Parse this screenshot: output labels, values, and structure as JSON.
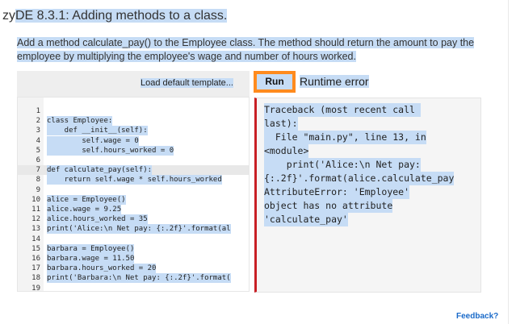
{
  "header": {
    "prefix": "zy",
    "title": "DE 8.3.1: Adding methods to a class."
  },
  "description": "Add a method calculate_pay() to the Employee class. The method should return the amount to pay the employee by multiplying the employee's wage and number of hours worked.",
  "toolbar": {
    "load_template_label": "Load default template...",
    "run_label": "Run",
    "status": "Runtime error"
  },
  "editor": {
    "lines": [
      {
        "num": "1",
        "code": ""
      },
      {
        "num": "2",
        "code": "class Employee:"
      },
      {
        "num": "3",
        "code": "    def __init__(self):"
      },
      {
        "num": "4",
        "code": "        self.wage = 0"
      },
      {
        "num": "5",
        "code": "        self.hours_worked = 0"
      },
      {
        "num": "6",
        "code": ""
      },
      {
        "num": "7",
        "code": "def calculate_pay(self):"
      },
      {
        "num": "8",
        "code": "    return self.wage * self.hours_worked"
      },
      {
        "num": "9",
        "code": ""
      },
      {
        "num": "10",
        "code": "alice = Employee()"
      },
      {
        "num": "11",
        "code": "alice.wage = 9.25"
      },
      {
        "num": "12",
        "code": "alice.hours_worked = 35"
      },
      {
        "num": "13",
        "code": "print('Alice:\\n Net pay: {:.2f}'.format(al"
      },
      {
        "num": "14",
        "code": ""
      },
      {
        "num": "15",
        "code": "barbara = Employee()"
      },
      {
        "num": "16",
        "code": "barbara.wage = 11.50"
      },
      {
        "num": "17",
        "code": "barbara.hours_worked = 20"
      },
      {
        "num": "18",
        "code": "print('Barbara:\\n Net pay: {:.2f}'.format("
      },
      {
        "num": "19",
        "code": ""
      }
    ]
  },
  "output": {
    "lines": [
      "Traceback (most recent call ",
      "last):",
      "  File \"main.py\", line 13, in",
      "<module>",
      "    print('Alice:\\n Net pay:",
      "{:.2f}'.format(alice.calculate_pay",
      "AttributeError: 'Employee'",
      "object has no attribute",
      "'calculate_pay'"
    ]
  },
  "footer": {
    "feedback_label": "Feedback?"
  },
  "colors": {
    "run_button": "#ff8b1e",
    "error_border": "#c81f25",
    "highlight": "#c6dcf5",
    "link": "#1a6ac9"
  }
}
